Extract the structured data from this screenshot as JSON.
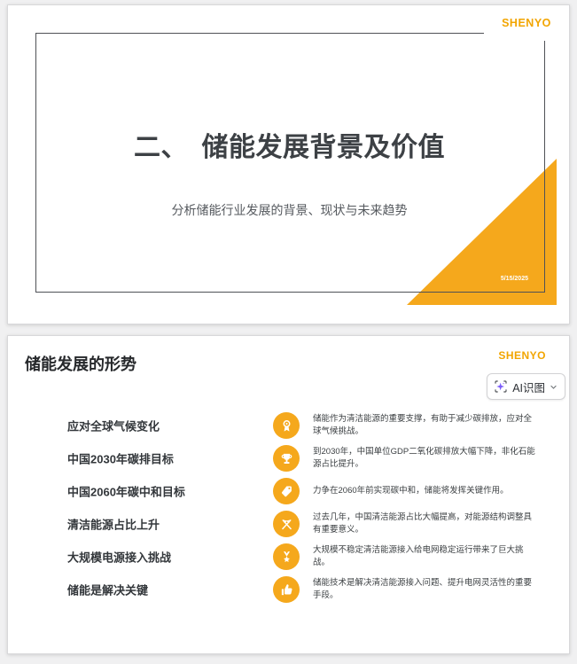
{
  "colors": {
    "accent": "#F5A81C",
    "logo": "#F2A500",
    "sparkle": "#7C5CFA",
    "title_dark": "#3D4145",
    "background": "#F0F0F1"
  },
  "slide1": {
    "logo": "SHENYO",
    "title": "二、　储能发展背景及价值",
    "subtitle": "分析储能行业发展的背景、现状与未来趋势",
    "date": "5/15/2025",
    "corner_shape": "orange-triangle"
  },
  "slide2": {
    "logo": "SHENYO",
    "heading": "储能发展的形势",
    "ai_button": {
      "label": "AI识图",
      "leading_icon": "ai-scan-sparkle-icon",
      "trailing_icon": "chevron-down-icon"
    },
    "items": [
      {
        "title": "应对全球气候变化",
        "icon": "award-icon",
        "desc": "储能作为清洁能源的重要支撑，有助于减少碳排放，应对全球气候挑战。"
      },
      {
        "title": "中国2030年碳排目标",
        "icon": "trophy-icon",
        "desc": "到2030年，中国单位GDP二氧化碳排放大幅下降，非化石能源占比提升。"
      },
      {
        "title": "中国2060年碳中和目标",
        "icon": "tag-icon",
        "desc": "力争在2060年前实现碳中和，储能将发挥关键作用。"
      },
      {
        "title": "清洁能源占比上升",
        "icon": "flags-icon",
        "desc": "过去几年，中国清洁能源占比大幅提高，对能源结构调整具有重要意义。"
      },
      {
        "title": "大规模电源接入挑战",
        "icon": "medal-icon",
        "desc": "大规模不稳定清洁能源接入给电网稳定运行带来了巨大挑战。"
      },
      {
        "title": "储能是解决关键",
        "icon": "thumbs-up-icon",
        "desc": "储能技术是解决清洁能源接入问题、提升电网灵活性的重要手段。"
      }
    ]
  }
}
